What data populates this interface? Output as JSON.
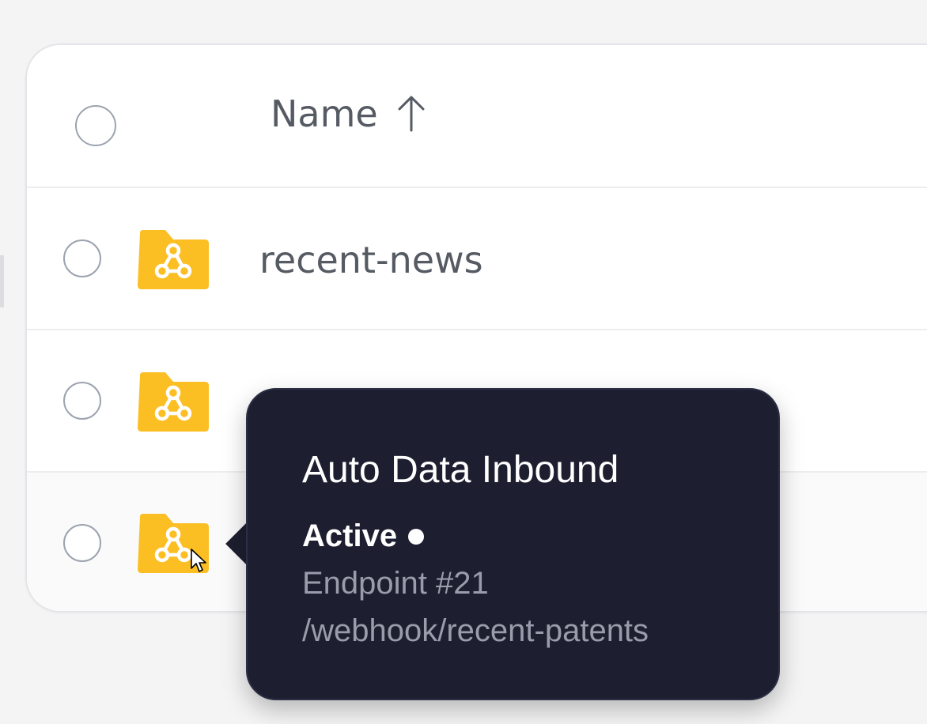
{
  "table": {
    "header": {
      "name_label": "Name",
      "sort_icon": "arrow-up-icon"
    },
    "rows": [
      {
        "name": "recent-news",
        "icon": "webhook-folder-icon"
      },
      {
        "name": "",
        "icon": "webhook-folder-icon"
      },
      {
        "name": "",
        "icon": "webhook-folder-icon"
      }
    ]
  },
  "tooltip": {
    "title": "Auto Data Inbound",
    "status": "Active",
    "endpoint": "Endpoint #21",
    "path": "/webhook/recent-patents"
  },
  "colors": {
    "folder": "#fbbf24",
    "tooltip_bg": "#1d1f30",
    "text_muted": "#9a9cab",
    "name_text": "#555a63"
  }
}
